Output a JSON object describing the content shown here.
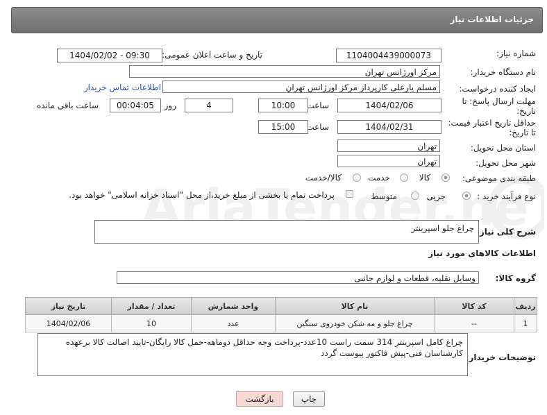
{
  "title": "جزئیات اطلاعات نیاز",
  "fields": {
    "need_number_label": "شماره نیاز:",
    "need_number": "1104004439000073",
    "announce_label": "تاریخ و ساعت اعلان عمومی:",
    "announce_value": "1404/02/02 - 09:30",
    "buyer_org_label": "نام دستگاه خریدار:",
    "buyer_org": "مرکز اورژانس تهران",
    "requester_label": "ایجاد کننده درخواست:",
    "requester": "مسلم یارعلی کارپرداز مرکز اورژانس تهران",
    "contact_link": "اطلاعات تماس خریدار",
    "deadline_label_1": "مهلت ارسال پاسخ: تا",
    "deadline_label_2": "تاریخ:",
    "deadline_date": "1404/02/06",
    "time_label": "ساعت",
    "deadline_time": "10:00",
    "days_value": "4",
    "days_label": "روز و",
    "remaining_value": "00:04:05",
    "remaining_label": "ساعت باقی مانده",
    "validity_label_1": "حداقل تاریخ اعتبار قیمت:",
    "validity_label_2": "تا تاریخ:",
    "validity_date": "1404/02/31",
    "validity_time": "15:00",
    "province_label": "استان محل تحویل:",
    "province": "تهران",
    "city_label": "شهر محل تحویل:",
    "city": "تهران",
    "category_label": "طبقه بندی موضوعی:",
    "category_options": [
      "کالا",
      "خدمت",
      "کالا/خدمت"
    ],
    "process_label": "نوع فرآیند خرید :",
    "process_options": [
      "جزیی",
      "متوسط"
    ],
    "payment_note": "پرداخت تمام یا بخشی از مبلغ خرید،از محل \"اسناد خزانه اسلامی\" خواهد بود."
  },
  "summary": {
    "label": "شرح کلی نیاز:",
    "value": "چراغ جلو اسپرینتر"
  },
  "goods_section": {
    "title": "اطلاعات کالاهای مورد نیاز",
    "group_label": "گروه کالا:",
    "group_value": "وسایل نقلیه، قطعات و لوازم جانبی"
  },
  "table": {
    "headers": [
      "ردیف",
      "کد کالا",
      "نام کالا",
      "واحد شمارش",
      "تعداد / مقدار",
      "تاریخ نیاز"
    ],
    "rows": [
      [
        "1",
        "--",
        "چراغ جلو و مه شکن خودروی سنگین",
        "عدد",
        "10",
        "1404/02/06"
      ]
    ]
  },
  "buyer_notes": {
    "label": "توضیحات خریدار:",
    "text": "چراغ کامل اسپرینتر 314 سمت راست     10عدد-پرداخت وجه حداقل دوماهه-حمل کالا رایگان-تایید اصالت کالا برعهده کارشناسان فنی-پیش فاکتور پیوست گردد"
  },
  "buttons": {
    "print": "چاپ",
    "back": "بازگشت"
  },
  "watermark_text": "AriaTender.neT"
}
